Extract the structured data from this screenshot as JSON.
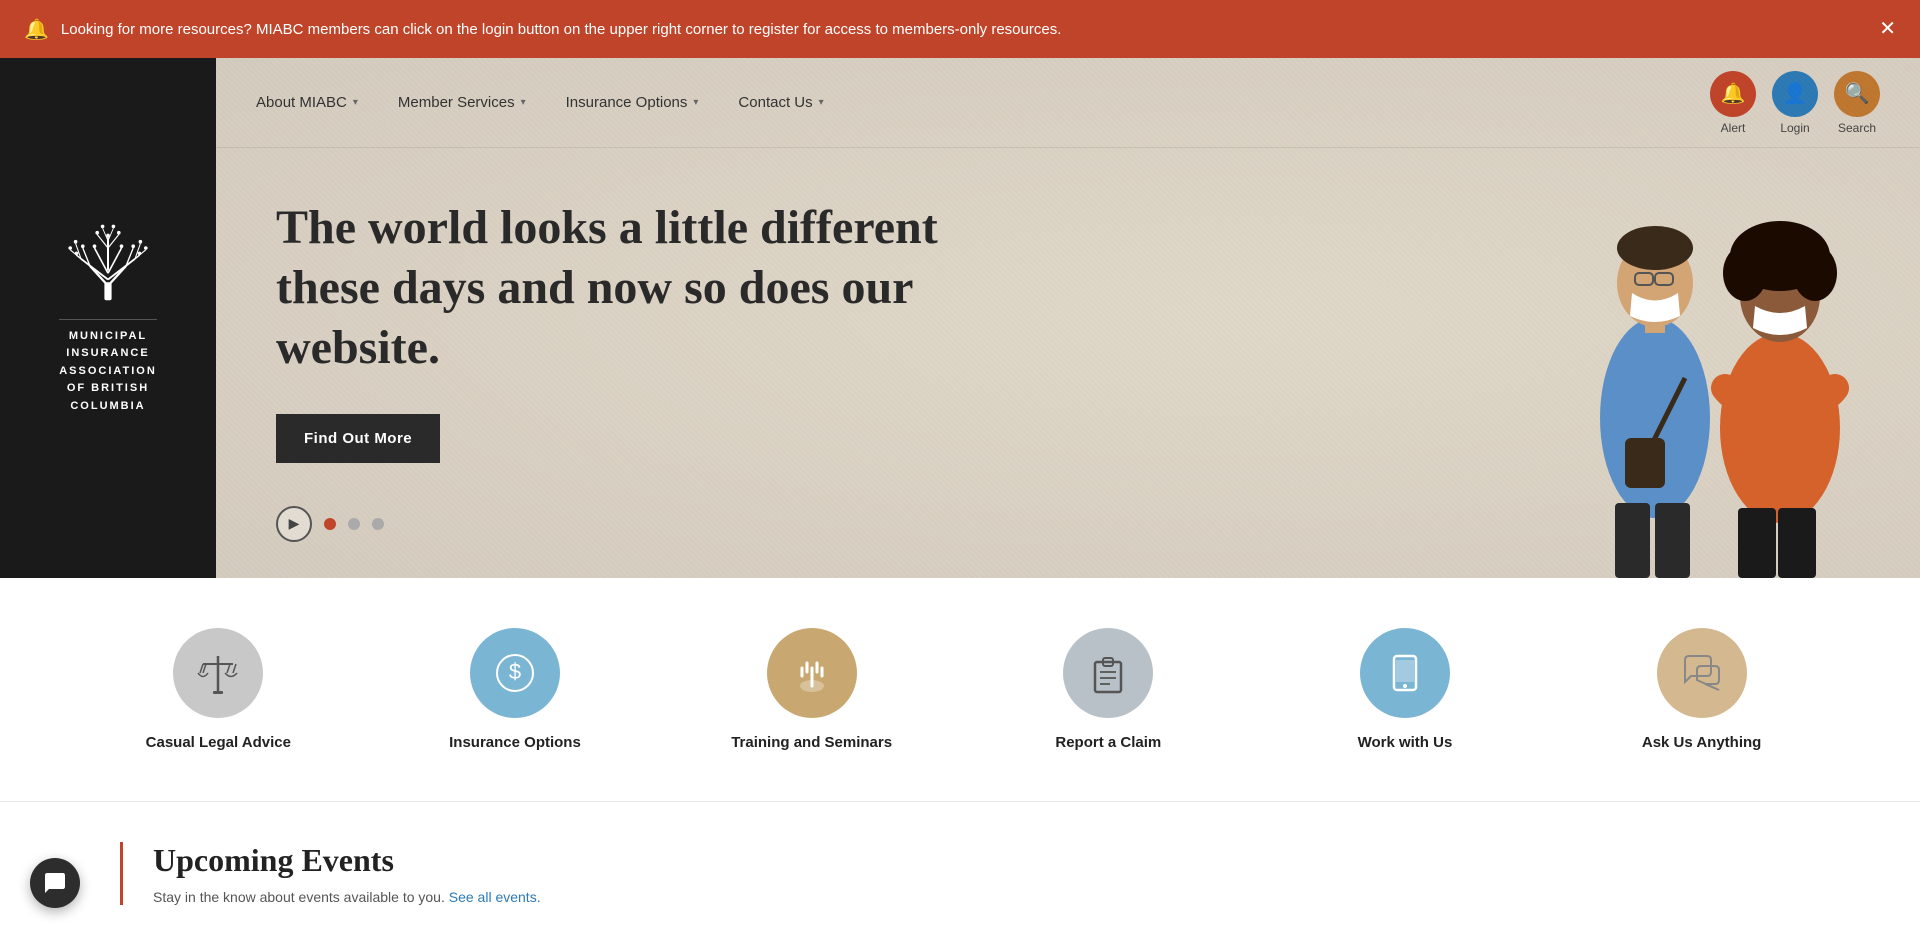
{
  "alert": {
    "message": "Looking for more resources? MIABC members can click on the login button on the upper right corner to register for access to members-only resources.",
    "bg_color": "#c0442a"
  },
  "logo": {
    "org_name": "MUNICIPAL\nINSURANCE\nASSOCIATION\nOF BRITISH\nCOLUMBIA"
  },
  "nav": {
    "links": [
      {
        "label": "About MIABC",
        "has_dropdown": true
      },
      {
        "label": "Member Services",
        "has_dropdown": true
      },
      {
        "label": "Insurance Options",
        "has_dropdown": true
      },
      {
        "label": "Contact Us",
        "has_dropdown": true
      }
    ],
    "actions": [
      {
        "label": "Alert",
        "icon": "🔔",
        "style": "alert"
      },
      {
        "label": "Login",
        "icon": "👤",
        "style": "login"
      },
      {
        "label": "Search",
        "icon": "🔍",
        "style": "search"
      }
    ]
  },
  "hero": {
    "title": "The world looks a little different these days and now so does our website.",
    "button_label": "Find Out More"
  },
  "carousel": {
    "dots": [
      {
        "active": true
      },
      {
        "active": false
      },
      {
        "active": false
      }
    ]
  },
  "services": [
    {
      "label": "Casual Legal Advice",
      "icon": "⚖",
      "icon_style": "legal"
    },
    {
      "label": "Insurance Options",
      "icon": "💰",
      "icon_style": "insurance"
    },
    {
      "label": "Training and Seminars",
      "icon": "✋",
      "icon_style": "training"
    },
    {
      "label": "Report a Claim",
      "icon": "📋",
      "icon_style": "claim"
    },
    {
      "label": "Work with Us",
      "icon": "📱",
      "icon_style": "work"
    },
    {
      "label": "Ask Us Anything",
      "icon": "💬",
      "icon_style": "ask"
    }
  ],
  "upcoming": {
    "title": "Upcoming Events",
    "subtitle": "Stay in the know about events available to you.",
    "link_text": "See all events.",
    "link_href": "#"
  }
}
